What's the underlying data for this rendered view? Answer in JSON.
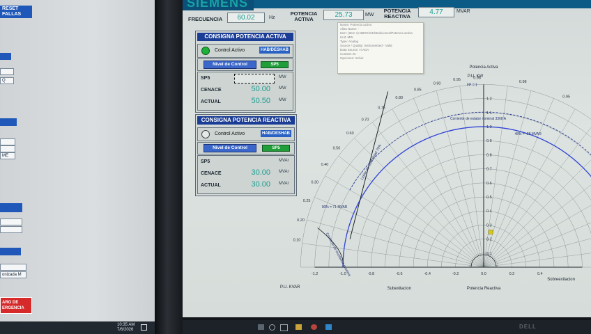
{
  "left_monitor": {
    "reset_button": [
      "RESET",
      "FALLAS"
    ],
    "field_fragments": [
      "Q",
      "ME",
      "onizada M"
    ],
    "emergency_button": [
      "ARO DE",
      "ERGENCIA"
    ],
    "taskbar": {
      "time": "10:35 AM",
      "date": "7/6/2026"
    }
  },
  "header": {
    "brand": "SIEMENS",
    "frequency": {
      "label": "FRECUENCIA",
      "value": "60.02",
      "unit": "Hz"
    },
    "active_power": {
      "label": [
        "POTENCIA",
        "ACTIVA"
      ],
      "value": "25.73",
      "unit": "MW"
    },
    "reactive_power": {
      "label": [
        "POTENCIA",
        "REACTIVA"
      ],
      "value": "4.77",
      "unit": "MVAR"
    }
  },
  "tooltip": {
    "lines": [
      "Name: Potencia activa",
      "Alias Name: -",
      "Item: (Item 1) NBGK/G1/Mediciones/Potencia activa",
      "Unit: MW",
      "Type: Analog",
      "Source / Quality: Instrumented - Valid",
      "Data Source: H.ADA",
      "Context: ID",
      "Opciones: Incluir"
    ]
  },
  "active_setpoint": {
    "title": "CONSIGNA POTENCIA ACTIVA",
    "control_label": "Control Activo",
    "toggle_label": "HAB/DESHAB",
    "level_label": "Nivel de Control",
    "sp_label": "SP5",
    "rows": [
      {
        "label": "SP5",
        "value": "",
        "unit": "MW"
      },
      {
        "label": "CENACE",
        "value": "50.00",
        "unit": "MW"
      },
      {
        "label": "ACTUAL",
        "value": "50.50",
        "unit": "MW"
      }
    ],
    "indicator_color": "#1fb23a"
  },
  "reactive_setpoint": {
    "title": "CONSIGNA POTENCIA REACTIVA",
    "control_label": "Control Activo",
    "toggle_label": "HAB/DESHAB",
    "level_label": "Nivel de Control",
    "sp_label": "SP5",
    "rows": [
      {
        "label": "SP5",
        "value": "",
        "unit": "MVAr"
      },
      {
        "label": "CENACE",
        "value": "30.00",
        "unit": "MVAr"
      },
      {
        "label": "ACTUAL",
        "value": "30.00",
        "unit": "MVAr"
      }
    ],
    "indicator_color": "#e6e9ea"
  },
  "chart_data": {
    "type": "scatter",
    "title": "Potencia Activa",
    "xlabel": "Potencia Reactiva",
    "ylabel": "P.U. KW",
    "x_unit_label": "P.U. KVAR",
    "xlim": [
      -1.2,
      1.2
    ],
    "ylim": [
      0,
      1.3
    ],
    "x_ticks": [
      -1.2,
      -1.0,
      -0.8,
      -0.6,
      -0.4,
      -0.2,
      0.0,
      0.2,
      0.4
    ],
    "y_ticks": [
      0.1,
      0.2,
      0.3,
      0.4,
      0.5,
      0.6,
      0.7,
      0.8,
      0.9,
      1.0,
      1.1,
      1.2
    ],
    "region_labels": [
      "Subexitacion",
      "Sobreexitacion"
    ],
    "power_factor_labels": [
      "0.10",
      "0.20",
      "0.25",
      "0.30",
      "0.40",
      "0.50",
      "0.60",
      "0.70",
      "0.75",
      "0.80",
      "0.85",
      "0.90",
      "0.95",
      "0.98"
    ],
    "annotations": [
      "FP = 1",
      "Corriente de estator nominal 3308 A",
      "Limite de estabilidad 70%",
      "Corriente de excitacion minima",
      "48% = -28 MVAR",
      "90% = 71 MVAR",
      "Corriente de excitacion maxima"
    ],
    "operating_point": {
      "x": 0.05,
      "y": 0.25,
      "color": "#d8c81c"
    }
  },
  "taskbar": {
    "brand": "DELL"
  }
}
